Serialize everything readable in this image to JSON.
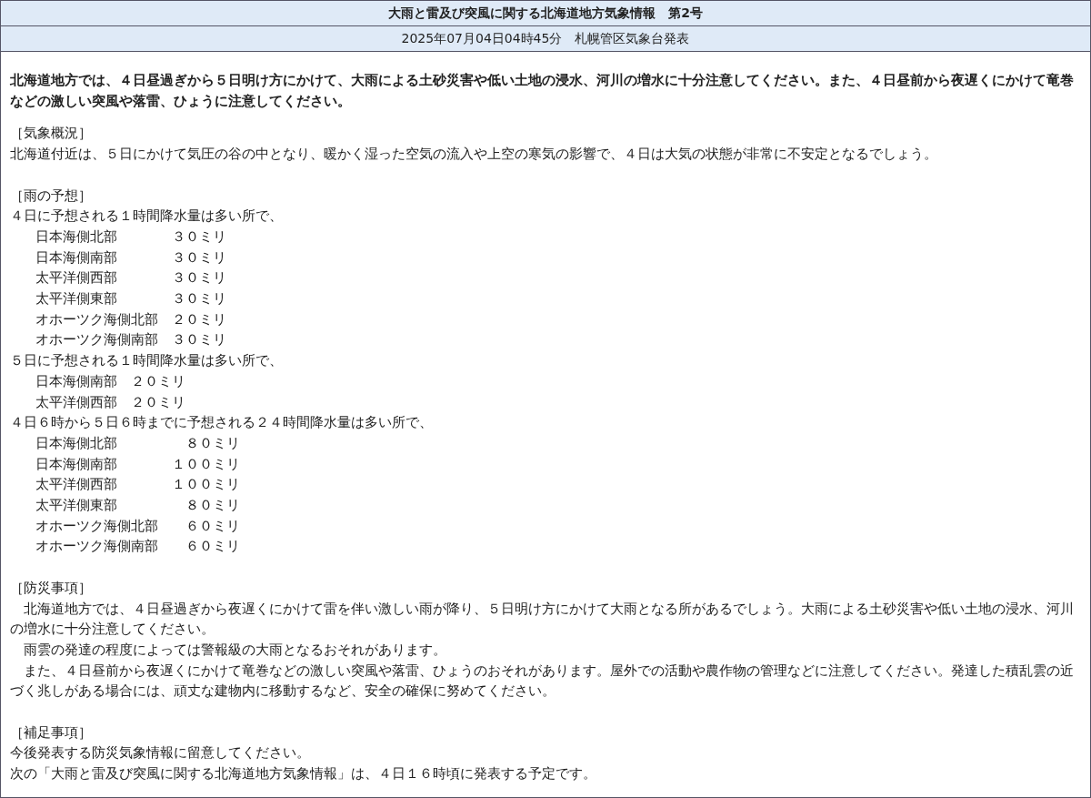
{
  "header": {
    "title": "大雨と雷及び突風に関する北海道地方気象情報　第2号",
    "issued": "2025年07月04日04時45分　札幌管区気象台発表"
  },
  "headline": "北海道地方では、４日昼過ぎから５日明け方にかけて、大雨による土砂災害や低い土地の浸水、河川の増水に十分注意してください。また、４日昼前から夜遅くにかけて竜巻などの激しい突風や落雷、ひょうに注意してください。",
  "sections": [
    {
      "heading": "［気象概況］",
      "paragraphs": [
        {
          "text": "北海道付近は、５日にかけて気圧の谷の中となり、暖かく湿った空気の流入や上空の寒気の影響で、４日は大気の状態が非常に不安定となるでしょう。",
          "indented": false
        }
      ]
    },
    {
      "heading": "［雨の予想］",
      "groups": [
        {
          "intro": "４日に予想される１時間降水量は多い所で、",
          "rows": [
            {
              "area": "日本海側北部",
              "amount": "３０ミリ"
            },
            {
              "area": "日本海側南部",
              "amount": "３０ミリ"
            },
            {
              "area": "太平洋側西部",
              "amount": "３０ミリ"
            },
            {
              "area": "太平洋側東部",
              "amount": "３０ミリ"
            },
            {
              "area": "オホーツク海側北部",
              "amount": "２０ミリ"
            },
            {
              "area": "オホーツク海側南部",
              "amount": "３０ミリ"
            }
          ]
        },
        {
          "intro": "５日に予想される１時間降水量は多い所で、",
          "rows": [
            {
              "area": "日本海側南部",
              "amount": "２０ミリ"
            },
            {
              "area": "太平洋側西部",
              "amount": "２０ミリ"
            }
          ]
        },
        {
          "intro": "４日６時から５日６時までに予想される２４時間降水量は多い所で、",
          "rows": [
            {
              "area": "日本海側北部",
              "amount": "８０ミリ"
            },
            {
              "area": "日本海側南部",
              "amount": "１００ミリ"
            },
            {
              "area": "太平洋側西部",
              "amount": "１００ミリ"
            },
            {
              "area": "太平洋側東部",
              "amount": "８０ミリ"
            },
            {
              "area": "オホーツク海側北部",
              "amount": "６０ミリ"
            },
            {
              "area": "オホーツク海側南部",
              "amount": "６０ミリ"
            }
          ]
        }
      ]
    },
    {
      "heading": "［防災事項］",
      "paragraphs": [
        {
          "text": "北海道地方では、４日昼過ぎから夜遅くにかけて雷を伴い激しい雨が降り、５日明け方にかけて大雨となる所があるでしょう。大雨による土砂災害や低い土地の浸水、河川の増水に十分注意してください。",
          "indented": true
        },
        {
          "text": "雨雲の発達の程度によっては警報級の大雨となるおそれがあります。",
          "indented": true
        },
        {
          "text": "また、４日昼前から夜遅くにかけて竜巻などの激しい突風や落雷、ひょうのおそれがあります。屋外での活動や農作物の管理などに注意してください。発達した積乱雲の近づく兆しがある場合には、頑丈な建物内に移動するなど、安全の確保に努めてください。",
          "indented": true
        }
      ]
    },
    {
      "heading": "［補足事項］",
      "paragraphs": [
        {
          "text": "今後発表する防災気象情報に留意してください。",
          "indented": false
        },
        {
          "text": "次の「大雨と雷及び突風に関する北海道地方気象情報」は、４日１６時頃に発表する予定です。",
          "indented": false
        }
      ]
    }
  ]
}
